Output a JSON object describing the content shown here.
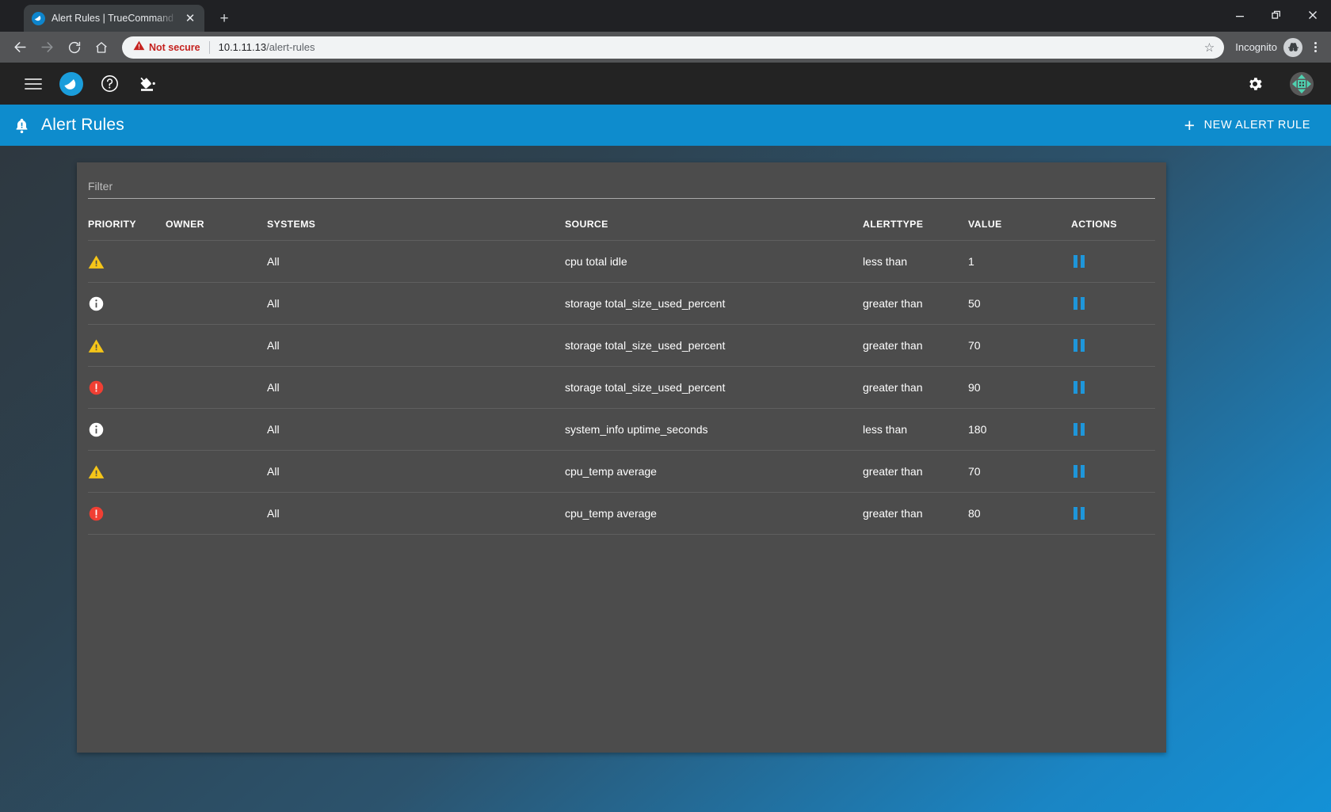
{
  "browser": {
    "tab": {
      "title": "Alert Rules | TrueCommand",
      "favicon_icon": "truecommand-logo-icon",
      "close_icon": "close-icon"
    },
    "new_tab_label": "+",
    "window_controls": {
      "minimize_icon": "minimize-icon",
      "maximize_icon": "restore-icon",
      "close_icon": "close-icon"
    },
    "toolbar": {
      "back_icon": "back-arrow-icon",
      "forward_icon": "forward-arrow-icon",
      "reload_icon": "reload-icon",
      "home_icon": "home-icon",
      "security_warning_icon": "warning-triangle-icon",
      "security_label": "Not secure",
      "url_host": "10.1.11.13",
      "url_path": "/alert-rules",
      "bookmark_icon": "star-icon",
      "incognito_label": "Incognito",
      "incognito_icon": "incognito-hat-icon",
      "menu_icon": "kebab-menu-icon"
    }
  },
  "app": {
    "topbar": {
      "menu_icon": "hamburger-menu-icon",
      "logo_icon": "truecommand-logo-icon",
      "help_icon": "help-circle-icon",
      "theme_icon": "paint-bucket-icon",
      "settings_icon": "gear-icon",
      "avatar_icon": "user-avatar-icon"
    },
    "header": {
      "icon": "alert-bell-icon",
      "title": "Alert Rules",
      "new_rule_label": "NEW ALERT RULE",
      "new_rule_icon": "plus-icon",
      "accent_color": "#0e8ccd"
    },
    "filter": {
      "placeholder": "Filter",
      "value": ""
    },
    "table": {
      "columns": [
        "PRIORITY",
        "OWNER",
        "SYSTEMS",
        "SOURCE",
        "ALERTTYPE",
        "VALUE",
        "ACTIONS"
      ],
      "priority_colors": {
        "warning": "#f5c518",
        "info": "#ffffff",
        "error": "#f03f33"
      },
      "action_icon": "pause-icon",
      "action_color": "#1e96da",
      "rows": [
        {
          "priority": "warning",
          "priority_icon": "warning-triangle-icon",
          "owner": "",
          "systems": "All",
          "source": "cpu total idle",
          "alerttype": "less than",
          "value": "1",
          "action_label": "pause"
        },
        {
          "priority": "info",
          "priority_icon": "info-circle-icon",
          "owner": "",
          "systems": "All",
          "source": "storage total_size_used_percent",
          "alerttype": "greater than",
          "value": "50",
          "action_label": "pause"
        },
        {
          "priority": "warning",
          "priority_icon": "warning-triangle-icon",
          "owner": "",
          "systems": "All",
          "source": "storage total_size_used_percent",
          "alerttype": "greater than",
          "value": "70",
          "action_label": "pause"
        },
        {
          "priority": "error",
          "priority_icon": "error-circle-icon",
          "owner": "",
          "systems": "All",
          "source": "storage total_size_used_percent",
          "alerttype": "greater than",
          "value": "90",
          "action_label": "pause"
        },
        {
          "priority": "info",
          "priority_icon": "info-circle-icon",
          "owner": "",
          "systems": "All",
          "source": "system_info uptime_seconds",
          "alerttype": "less than",
          "value": "180",
          "action_label": "pause"
        },
        {
          "priority": "warning",
          "priority_icon": "warning-triangle-icon",
          "owner": "",
          "systems": "All",
          "source": "cpu_temp average",
          "alerttype": "greater than",
          "value": "70",
          "action_label": "pause"
        },
        {
          "priority": "error",
          "priority_icon": "error-circle-icon",
          "owner": "",
          "systems": "All",
          "source": "cpu_temp average",
          "alerttype": "greater than",
          "value": "80",
          "action_label": "pause"
        }
      ]
    }
  }
}
